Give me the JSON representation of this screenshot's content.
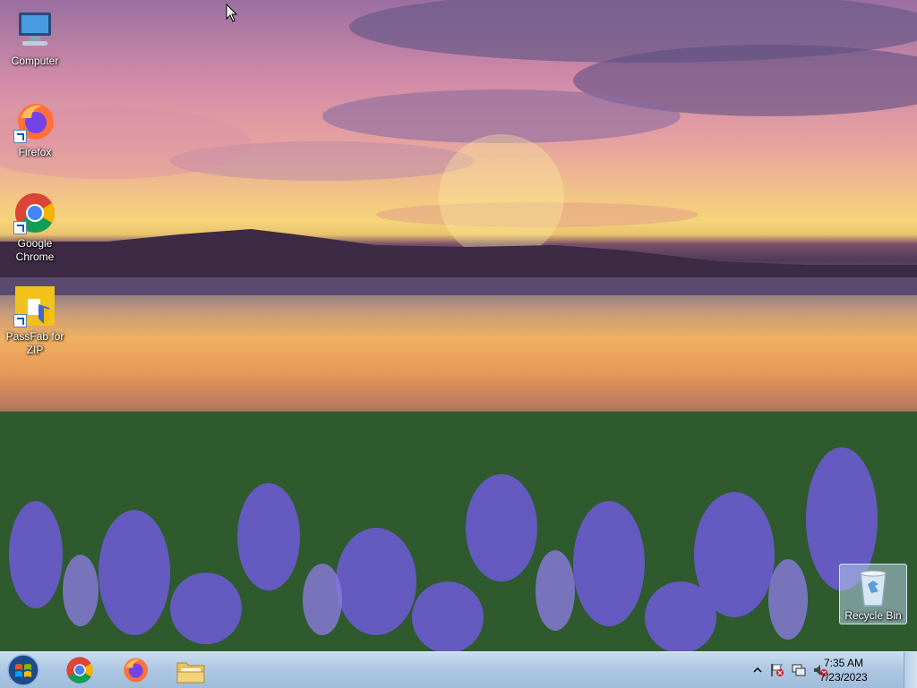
{
  "desktop": {
    "icons": [
      {
        "label": "Computer",
        "icon": "computer-icon"
      },
      {
        "label": "Firefox",
        "icon": "firefox-icon"
      },
      {
        "label": "Google\nChrome",
        "icon": "chrome-icon"
      },
      {
        "label": "PassFab for\nZIP",
        "icon": "passfab-zip-icon"
      }
    ],
    "recycle_bin": {
      "label": "Recycle Bin",
      "icon": "recycle-bin-icon"
    }
  },
  "taskbar": {
    "start": {
      "icon": "windows-start-icon"
    },
    "pinned": [
      {
        "name": "Google Chrome",
        "icon": "chrome-icon"
      },
      {
        "name": "Firefox",
        "icon": "firefox-icon"
      },
      {
        "name": "Windows Explorer",
        "icon": "folder-icon"
      }
    ],
    "tray": {
      "icons": [
        "show-hidden-icons-chevron",
        "action-center-flag-icon",
        "network-icon",
        "volume-muted-icon"
      ],
      "time": "7:35 AM",
      "date": "7/23/2023"
    }
  },
  "colors": {
    "taskbar_top": "#c9dcef",
    "taskbar_bottom": "#9fbcdb",
    "label_text": "#ffffff"
  }
}
